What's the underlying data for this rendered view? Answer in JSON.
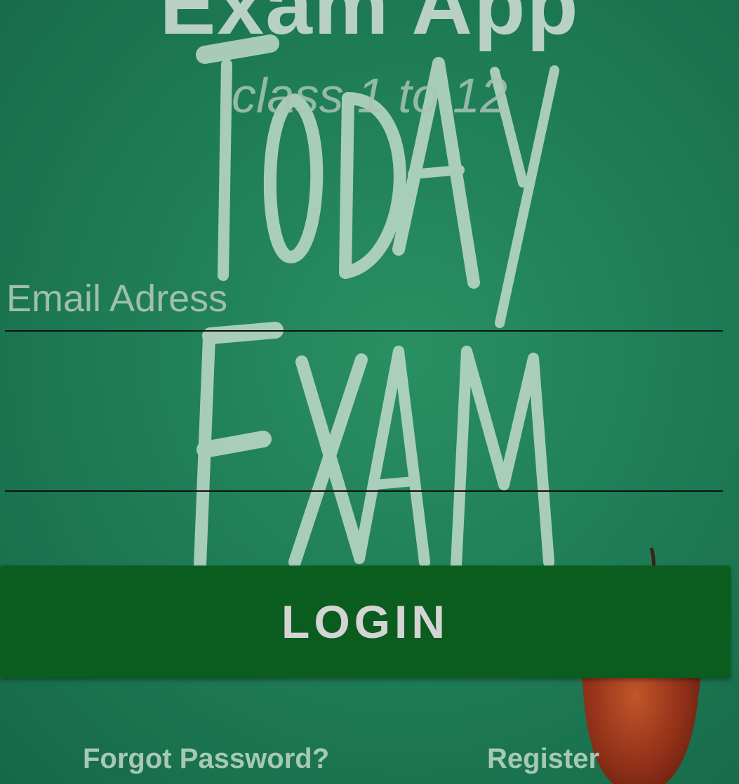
{
  "header": {
    "title": "Exam App",
    "subtitle": "class 1 to 12"
  },
  "form": {
    "email_placeholder": "Email Adress",
    "password_placeholder": "",
    "login_label": "LOGIN"
  },
  "footer": {
    "forgot_password_label": "Forgot Password?",
    "register_label": "Register"
  },
  "colors": {
    "background": "#1f7a54",
    "button": "#0a5c1f",
    "text_light": "#c9d9cf"
  },
  "icons": {
    "background_decoration": "chalkboard-today-exam-image",
    "apple": "apple-icon"
  }
}
